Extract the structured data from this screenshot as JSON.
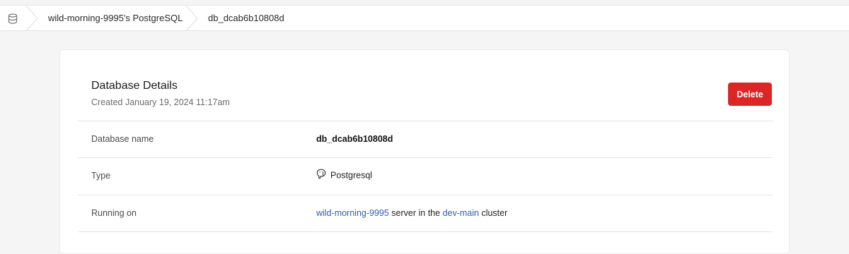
{
  "breadcrumb": {
    "home_icon": "database-icon",
    "items": [
      {
        "label": "wild-morning-9995's PostgreSQL"
      },
      {
        "label": "db_dcab6b10808d"
      }
    ]
  },
  "card": {
    "title": "Database Details",
    "created": "Created January 19, 2024 11:17am",
    "delete_label": "Delete",
    "delete_color": "#dc2626"
  },
  "details": {
    "name": {
      "label": "Database name",
      "value": "db_dcab6b10808d"
    },
    "type": {
      "label": "Type",
      "icon": "postgresql-elephant-icon",
      "value": "Postgresql"
    },
    "running_on": {
      "label": "Running on",
      "server": "wild-morning-9995",
      "middle": " server in the ",
      "cluster": "dev-main",
      "suffix": " cluster",
      "link_color": "#2f5fb0"
    }
  }
}
